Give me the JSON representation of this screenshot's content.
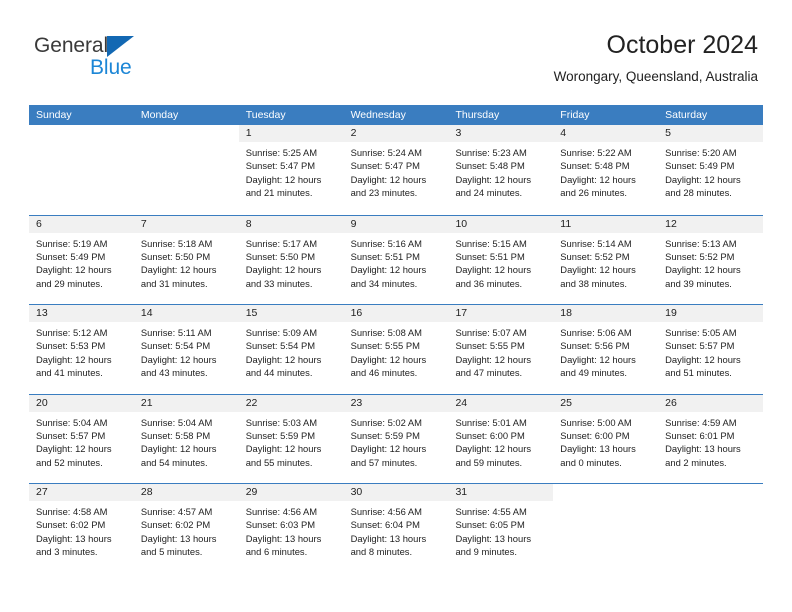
{
  "brand": {
    "name_part1": "General",
    "name_part2": "Blue"
  },
  "header": {
    "title": "October 2024",
    "subtitle": "Worongary, Queensland, Australia"
  },
  "colors": {
    "header_blue": "#3a7dc0",
    "logo_blue": "#1c86d6",
    "date_band": "#f1f1f1",
    "text": "#222222"
  },
  "weekdays": [
    "Sunday",
    "Monday",
    "Tuesday",
    "Wednesday",
    "Thursday",
    "Friday",
    "Saturday"
  ],
  "weeks": [
    [
      {
        "empty": true
      },
      {
        "empty": true
      },
      {
        "date": "1",
        "sunrise": "Sunrise: 5:25 AM",
        "sunset": "Sunset: 5:47 PM",
        "daylight1": "Daylight: 12 hours",
        "daylight2": "and 21 minutes."
      },
      {
        "date": "2",
        "sunrise": "Sunrise: 5:24 AM",
        "sunset": "Sunset: 5:47 PM",
        "daylight1": "Daylight: 12 hours",
        "daylight2": "and 23 minutes."
      },
      {
        "date": "3",
        "sunrise": "Sunrise: 5:23 AM",
        "sunset": "Sunset: 5:48 PM",
        "daylight1": "Daylight: 12 hours",
        "daylight2": "and 24 minutes."
      },
      {
        "date": "4",
        "sunrise": "Sunrise: 5:22 AM",
        "sunset": "Sunset: 5:48 PM",
        "daylight1": "Daylight: 12 hours",
        "daylight2": "and 26 minutes."
      },
      {
        "date": "5",
        "sunrise": "Sunrise: 5:20 AM",
        "sunset": "Sunset: 5:49 PM",
        "daylight1": "Daylight: 12 hours",
        "daylight2": "and 28 minutes."
      }
    ],
    [
      {
        "date": "6",
        "sunrise": "Sunrise: 5:19 AM",
        "sunset": "Sunset: 5:49 PM",
        "daylight1": "Daylight: 12 hours",
        "daylight2": "and 29 minutes."
      },
      {
        "date": "7",
        "sunrise": "Sunrise: 5:18 AM",
        "sunset": "Sunset: 5:50 PM",
        "daylight1": "Daylight: 12 hours",
        "daylight2": "and 31 minutes."
      },
      {
        "date": "8",
        "sunrise": "Sunrise: 5:17 AM",
        "sunset": "Sunset: 5:50 PM",
        "daylight1": "Daylight: 12 hours",
        "daylight2": "and 33 minutes."
      },
      {
        "date": "9",
        "sunrise": "Sunrise: 5:16 AM",
        "sunset": "Sunset: 5:51 PM",
        "daylight1": "Daylight: 12 hours",
        "daylight2": "and 34 minutes."
      },
      {
        "date": "10",
        "sunrise": "Sunrise: 5:15 AM",
        "sunset": "Sunset: 5:51 PM",
        "daylight1": "Daylight: 12 hours",
        "daylight2": "and 36 minutes."
      },
      {
        "date": "11",
        "sunrise": "Sunrise: 5:14 AM",
        "sunset": "Sunset: 5:52 PM",
        "daylight1": "Daylight: 12 hours",
        "daylight2": "and 38 minutes."
      },
      {
        "date": "12",
        "sunrise": "Sunrise: 5:13 AM",
        "sunset": "Sunset: 5:52 PM",
        "daylight1": "Daylight: 12 hours",
        "daylight2": "and 39 minutes."
      }
    ],
    [
      {
        "date": "13",
        "sunrise": "Sunrise: 5:12 AM",
        "sunset": "Sunset: 5:53 PM",
        "daylight1": "Daylight: 12 hours",
        "daylight2": "and 41 minutes."
      },
      {
        "date": "14",
        "sunrise": "Sunrise: 5:11 AM",
        "sunset": "Sunset: 5:54 PM",
        "daylight1": "Daylight: 12 hours",
        "daylight2": "and 43 minutes."
      },
      {
        "date": "15",
        "sunrise": "Sunrise: 5:09 AM",
        "sunset": "Sunset: 5:54 PM",
        "daylight1": "Daylight: 12 hours",
        "daylight2": "and 44 minutes."
      },
      {
        "date": "16",
        "sunrise": "Sunrise: 5:08 AM",
        "sunset": "Sunset: 5:55 PM",
        "daylight1": "Daylight: 12 hours",
        "daylight2": "and 46 minutes."
      },
      {
        "date": "17",
        "sunrise": "Sunrise: 5:07 AM",
        "sunset": "Sunset: 5:55 PM",
        "daylight1": "Daylight: 12 hours",
        "daylight2": "and 47 minutes."
      },
      {
        "date": "18",
        "sunrise": "Sunrise: 5:06 AM",
        "sunset": "Sunset: 5:56 PM",
        "daylight1": "Daylight: 12 hours",
        "daylight2": "and 49 minutes."
      },
      {
        "date": "19",
        "sunrise": "Sunrise: 5:05 AM",
        "sunset": "Sunset: 5:57 PM",
        "daylight1": "Daylight: 12 hours",
        "daylight2": "and 51 minutes."
      }
    ],
    [
      {
        "date": "20",
        "sunrise": "Sunrise: 5:04 AM",
        "sunset": "Sunset: 5:57 PM",
        "daylight1": "Daylight: 12 hours",
        "daylight2": "and 52 minutes."
      },
      {
        "date": "21",
        "sunrise": "Sunrise: 5:04 AM",
        "sunset": "Sunset: 5:58 PM",
        "daylight1": "Daylight: 12 hours",
        "daylight2": "and 54 minutes."
      },
      {
        "date": "22",
        "sunrise": "Sunrise: 5:03 AM",
        "sunset": "Sunset: 5:59 PM",
        "daylight1": "Daylight: 12 hours",
        "daylight2": "and 55 minutes."
      },
      {
        "date": "23",
        "sunrise": "Sunrise: 5:02 AM",
        "sunset": "Sunset: 5:59 PM",
        "daylight1": "Daylight: 12 hours",
        "daylight2": "and 57 minutes."
      },
      {
        "date": "24",
        "sunrise": "Sunrise: 5:01 AM",
        "sunset": "Sunset: 6:00 PM",
        "daylight1": "Daylight: 12 hours",
        "daylight2": "and 59 minutes."
      },
      {
        "date": "25",
        "sunrise": "Sunrise: 5:00 AM",
        "sunset": "Sunset: 6:00 PM",
        "daylight1": "Daylight: 13 hours",
        "daylight2": "and 0 minutes."
      },
      {
        "date": "26",
        "sunrise": "Sunrise: 4:59 AM",
        "sunset": "Sunset: 6:01 PM",
        "daylight1": "Daylight: 13 hours",
        "daylight2": "and 2 minutes."
      }
    ],
    [
      {
        "date": "27",
        "sunrise": "Sunrise: 4:58 AM",
        "sunset": "Sunset: 6:02 PM",
        "daylight1": "Daylight: 13 hours",
        "daylight2": "and 3 minutes."
      },
      {
        "date": "28",
        "sunrise": "Sunrise: 4:57 AM",
        "sunset": "Sunset: 6:02 PM",
        "daylight1": "Daylight: 13 hours",
        "daylight2": "and 5 minutes."
      },
      {
        "date": "29",
        "sunrise": "Sunrise: 4:56 AM",
        "sunset": "Sunset: 6:03 PM",
        "daylight1": "Daylight: 13 hours",
        "daylight2": "and 6 minutes."
      },
      {
        "date": "30",
        "sunrise": "Sunrise: 4:56 AM",
        "sunset": "Sunset: 6:04 PM",
        "daylight1": "Daylight: 13 hours",
        "daylight2": "and 8 minutes."
      },
      {
        "date": "31",
        "sunrise": "Sunrise: 4:55 AM",
        "sunset": "Sunset: 6:05 PM",
        "daylight1": "Daylight: 13 hours",
        "daylight2": "and 9 minutes."
      },
      {
        "empty": true
      },
      {
        "empty": true
      }
    ]
  ]
}
